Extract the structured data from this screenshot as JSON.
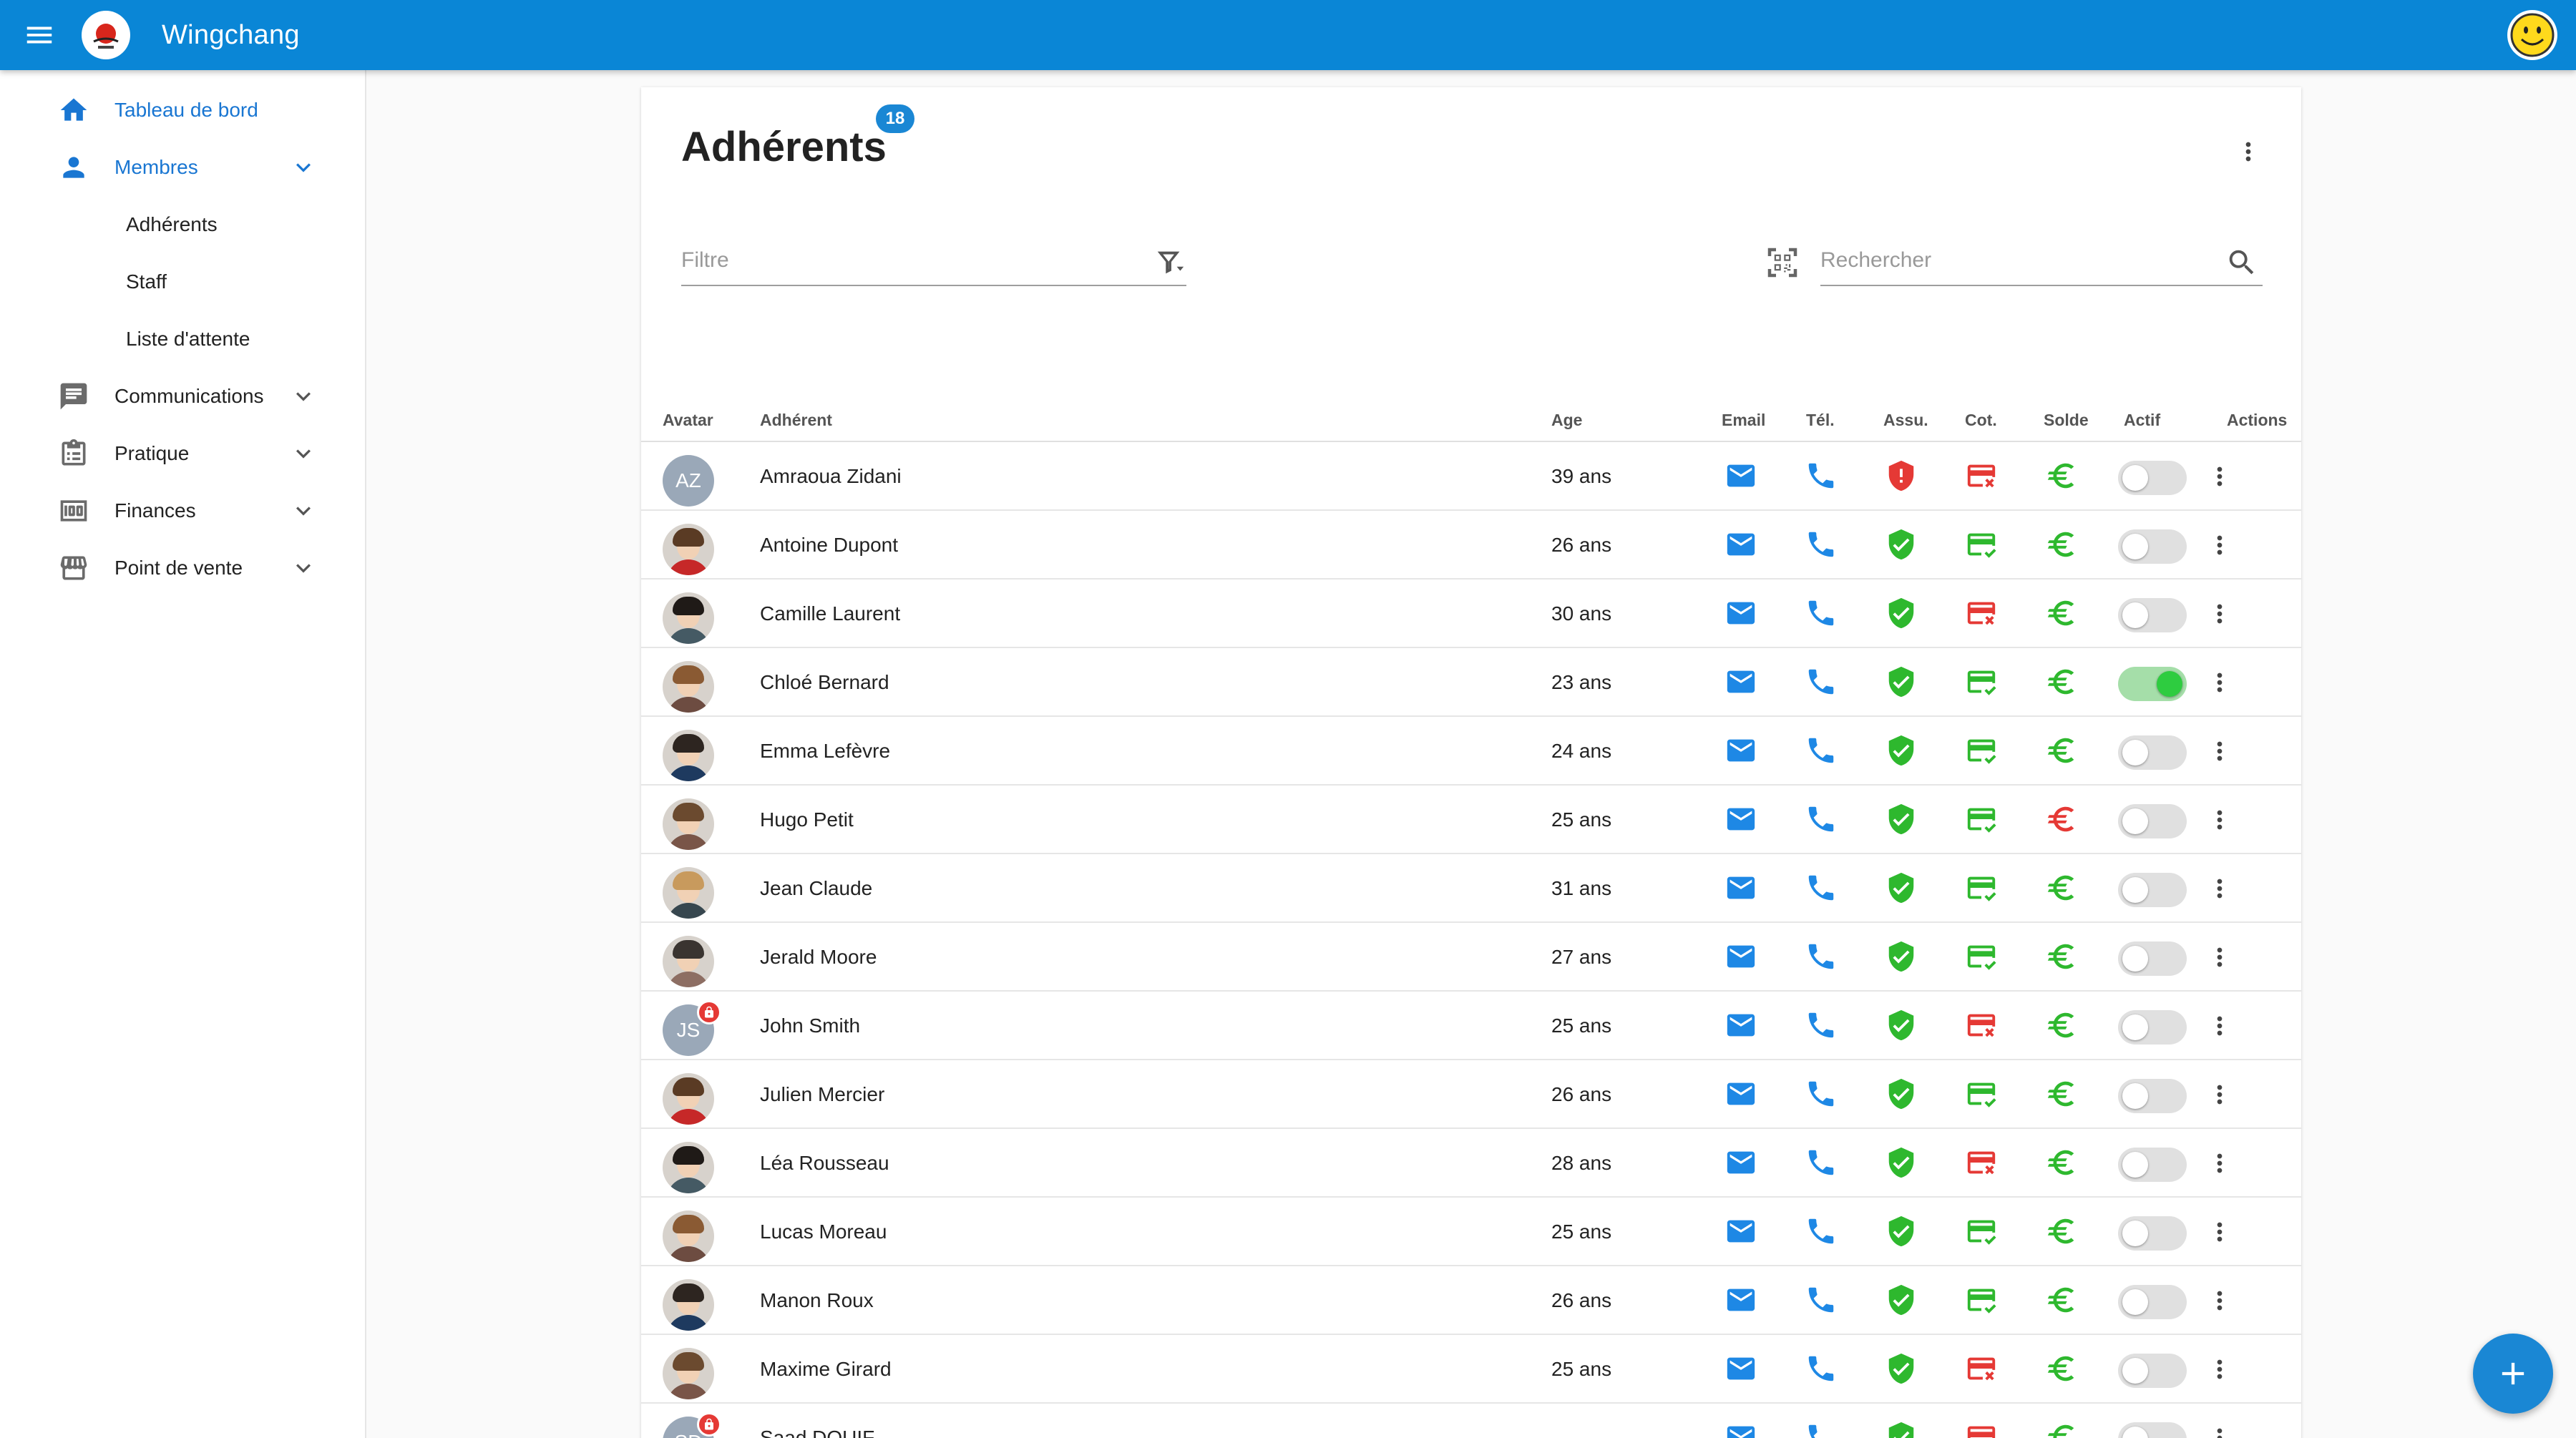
{
  "app": {
    "title": "Wingchang"
  },
  "sidebar": {
    "items": [
      {
        "label": "Tableau de bord",
        "icon": "home-icon",
        "primary": true
      },
      {
        "label": "Membres",
        "icon": "person-icon",
        "primary": true,
        "expanded": true,
        "children": [
          {
            "label": "Adhérents"
          },
          {
            "label": "Staff"
          },
          {
            "label": "Liste d'attente"
          }
        ]
      },
      {
        "label": "Communications",
        "icon": "chat-icon"
      },
      {
        "label": "Pratique",
        "icon": "clipboard-icon"
      },
      {
        "label": "Finances",
        "icon": "money-icon"
      },
      {
        "label": "Point de vente",
        "icon": "store-icon"
      }
    ]
  },
  "page": {
    "title": "Adhérents",
    "count": "18",
    "filter_placeholder": "Filtre",
    "search_placeholder": "Rechercher"
  },
  "table": {
    "columns": {
      "avatar": "Avatar",
      "member": "Adhérent",
      "age": "Age",
      "email": "Email",
      "phone": "Tél.",
      "insurance": "Assu.",
      "dues": "Cot.",
      "balance": "Solde",
      "active": "Actif",
      "actions": "Actions"
    },
    "rows": [
      {
        "avatar": "initials",
        "initials": "AZ",
        "name": "Amraoua Zidani",
        "age": "39 ans",
        "insurance": "missing",
        "dues": "unpaid",
        "balance": "ok",
        "active": false
      },
      {
        "avatar": "photo",
        "name": "Antoine Dupont",
        "age": "26 ans",
        "insurance": "ok",
        "dues": "paid",
        "balance": "ok",
        "active": false
      },
      {
        "avatar": "photo",
        "name": "Camille Laurent",
        "age": "30 ans",
        "insurance": "ok",
        "dues": "unpaid",
        "balance": "ok",
        "active": false
      },
      {
        "avatar": "photo",
        "name": "Chloé Bernard",
        "age": "23 ans",
        "insurance": "ok",
        "dues": "paid",
        "balance": "ok",
        "active": true
      },
      {
        "avatar": "photo",
        "name": "Emma Lefèvre",
        "age": "24 ans",
        "insurance": "ok",
        "dues": "paid",
        "balance": "ok",
        "active": false
      },
      {
        "avatar": "photo",
        "name": "Hugo Petit",
        "age": "25 ans",
        "insurance": "ok",
        "dues": "paid",
        "balance": "debt",
        "active": false
      },
      {
        "avatar": "photo",
        "name": "Jean Claude",
        "age": "31 ans",
        "insurance": "ok",
        "dues": "paid",
        "balance": "ok",
        "active": false
      },
      {
        "avatar": "photo",
        "name": "Jerald Moore",
        "age": "27 ans",
        "insurance": "ok",
        "dues": "paid",
        "balance": "ok",
        "active": false
      },
      {
        "avatar": "initials",
        "initials": "JS",
        "badge": true,
        "name": "John Smith",
        "age": "25 ans",
        "insurance": "ok",
        "dues": "unpaid",
        "balance": "ok",
        "active": false
      },
      {
        "avatar": "photo",
        "name": "Julien Mercier",
        "age": "26 ans",
        "insurance": "ok",
        "dues": "paid",
        "balance": "ok",
        "active": false
      },
      {
        "avatar": "photo",
        "name": "Léa Rousseau",
        "age": "28 ans",
        "insurance": "ok",
        "dues": "unpaid",
        "balance": "ok",
        "active": false
      },
      {
        "avatar": "photo",
        "name": "Lucas Moreau",
        "age": "25 ans",
        "insurance": "ok",
        "dues": "paid",
        "balance": "ok",
        "active": false
      },
      {
        "avatar": "photo",
        "name": "Manon Roux",
        "age": "26 ans",
        "insurance": "ok",
        "dues": "paid",
        "balance": "ok",
        "active": false
      },
      {
        "avatar": "photo",
        "name": "Maxime Girard",
        "age": "25 ans",
        "insurance": "ok",
        "dues": "unpaid",
        "balance": "ok",
        "active": false
      },
      {
        "avatar": "initials",
        "initials": "SD",
        "badge": true,
        "name": "Saad DOUIF",
        "age": "--",
        "insurance": "ok",
        "dues": "unpaid",
        "balance": "ok",
        "active": false
      }
    ]
  },
  "colors": {
    "primary": "#0a86d6",
    "accent_blue": "#1e88e5",
    "ok_green": "#2eb82e",
    "error_red": "#e53935"
  },
  "icons": {
    "email": "mail-icon",
    "phone": "phone-icon",
    "insurance_ok": "shield-check-icon",
    "insurance_missing": "shield-alert-icon",
    "dues_paid": "card-check-icon",
    "dues_unpaid": "card-x-icon",
    "balance": "euro-icon"
  }
}
